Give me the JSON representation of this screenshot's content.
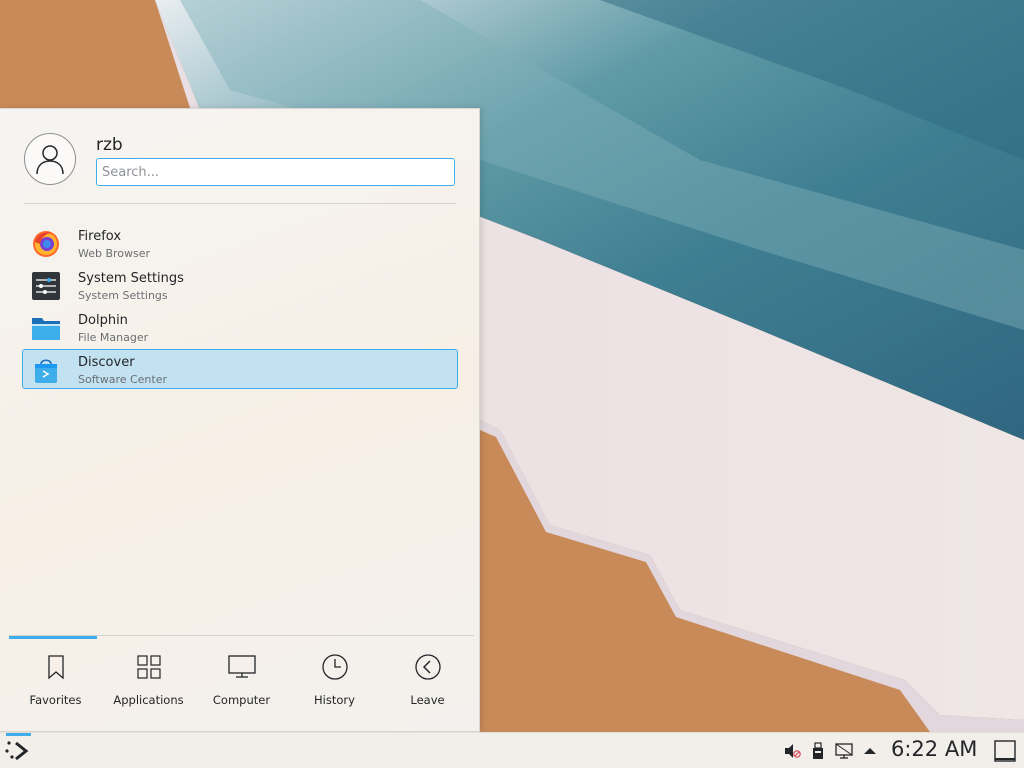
{
  "user": {
    "name": "rzb"
  },
  "search": {
    "placeholder": "Search..."
  },
  "favorites": [
    {
      "name": "Firefox",
      "description": "Web Browser",
      "icon": "firefox-icon"
    },
    {
      "name": "System Settings",
      "description": "System Settings",
      "icon": "system-settings-icon"
    },
    {
      "name": "Dolphin",
      "description": "File Manager",
      "icon": "folder-icon"
    },
    {
      "name": "Discover",
      "description": "Software Center",
      "icon": "shopping-bag-icon",
      "selected": true
    }
  ],
  "tabs": [
    {
      "label": "Favorites",
      "icon": "bookmark-icon",
      "active": true
    },
    {
      "label": "Applications",
      "icon": "grid-icon"
    },
    {
      "label": "Computer",
      "icon": "monitor-icon"
    },
    {
      "label": "History",
      "icon": "clock-icon"
    },
    {
      "label": "Leave",
      "icon": "back-arrow-icon"
    }
  ],
  "taskbar": {
    "clock": "6:22 AM",
    "tray_icons": [
      "volume-muted-icon",
      "usb-device-icon",
      "network-disconnected-icon",
      "tray-expand-arrow-icon"
    ]
  },
  "colors": {
    "accent": "#3daee9",
    "selection": "#c2e1f1"
  }
}
